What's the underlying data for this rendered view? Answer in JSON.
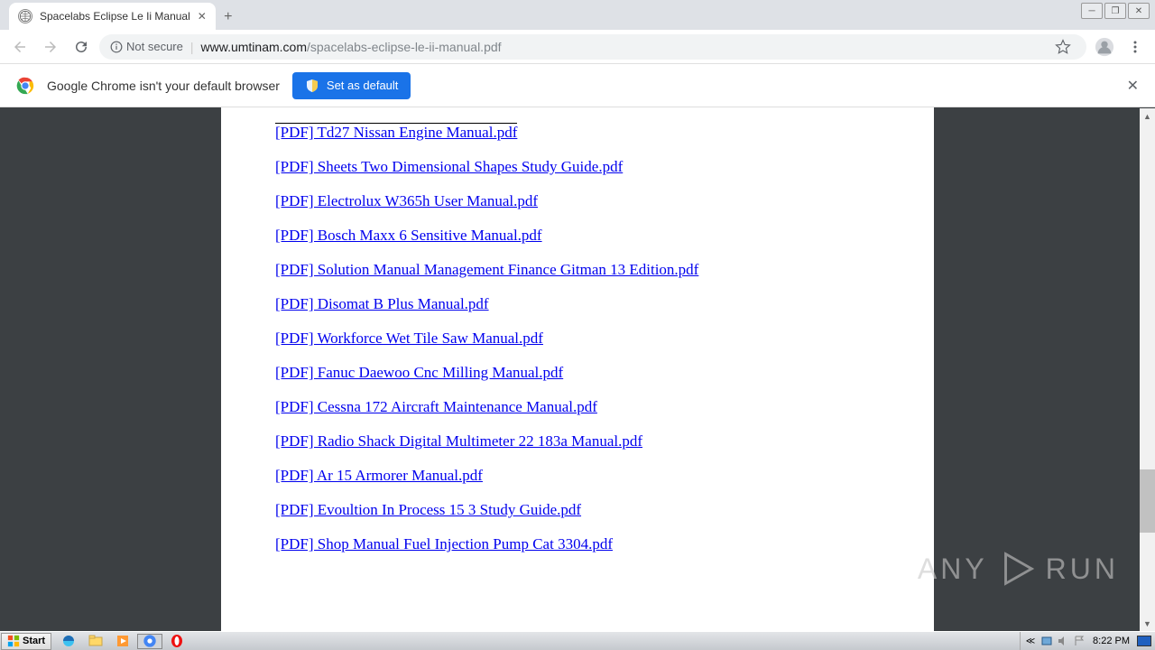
{
  "tab": {
    "title": "Spacelabs Eclipse Le Ii Manual"
  },
  "addr": {
    "not_secure": "Not secure",
    "host": "www.umtinam.com",
    "path": "/spacelabs-eclipse-le-ii-manual.pdf"
  },
  "infobar": {
    "msg": "Google Chrome isn't your default browser",
    "btn": "Set as default"
  },
  "links": [
    "[PDF] Td27 Nissan Engine Manual.pdf",
    "[PDF] Sheets Two Dimensional Shapes Study Guide.pdf",
    "[PDF] Electrolux W365h User Manual.pdf",
    "[PDF] Bosch Maxx 6 Sensitive Manual.pdf",
    "[PDF] Solution Manual Management Finance Gitman 13 Edition.pdf",
    "[PDF] Disomat B Plus Manual.pdf",
    "[PDF] Workforce Wet Tile Saw Manual.pdf",
    "[PDF] Fanuc Daewoo Cnc Milling Manual.pdf",
    "[PDF] Cessna 172 Aircraft Maintenance Manual.pdf",
    "[PDF] Radio Shack Digital Multimeter 22 183a Manual.pdf",
    "[PDF] Ar 15 Armorer Manual.pdf",
    "[PDF] Evoultion In Process 15 3 Study Guide.pdf",
    "[PDF] Shop Manual Fuel Injection Pump Cat 3304.pdf"
  ],
  "watermark": {
    "left": "ANY",
    "right": "RUN"
  },
  "taskbar": {
    "start": "Start",
    "clock": "8:22 PM"
  }
}
